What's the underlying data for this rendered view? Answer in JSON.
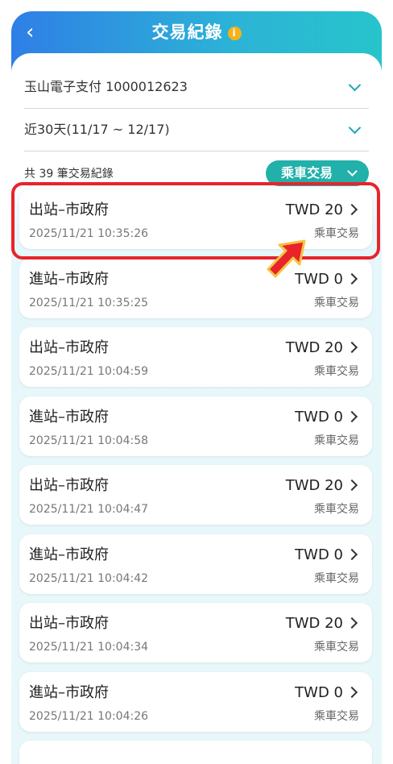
{
  "header": {
    "title": "交易紀錄",
    "info_glyph": "i"
  },
  "account_select": {
    "value": "玉山電子支付 1000012623"
  },
  "period_select": {
    "value": "近30天(11/17 ~ 12/17)"
  },
  "summary": {
    "count_text": "共 39 筆交易紀錄",
    "filter_label": "乘車交易"
  },
  "colors": {
    "header_start": "#2f7fe6",
    "header_end": "#27c4cc",
    "accent": "#22b0aa",
    "highlight": "#e8232a",
    "arrow": "#e8232a"
  },
  "transactions": [
    {
      "name": "出站–市政府",
      "time": "2025/11/21 10:35:26",
      "amount": "TWD 20",
      "type": "乘車交易"
    },
    {
      "name": "進站–市政府",
      "time": "2025/11/21 10:35:25",
      "amount": "TWD 0",
      "type": "乘車交易"
    },
    {
      "name": "出站–市政府",
      "time": "2025/11/21 10:04:59",
      "amount": "TWD 20",
      "type": "乘車交易"
    },
    {
      "name": "進站–市政府",
      "time": "2025/11/21 10:04:58",
      "amount": "TWD 0",
      "type": "乘車交易"
    },
    {
      "name": "出站–市政府",
      "time": "2025/11/21 10:04:47",
      "amount": "TWD 20",
      "type": "乘車交易"
    },
    {
      "name": "進站–市政府",
      "time": "2025/11/21 10:04:42",
      "amount": "TWD 0",
      "type": "乘車交易"
    },
    {
      "name": "出站–市政府",
      "time": "2025/11/21 10:04:34",
      "amount": "TWD 20",
      "type": "乘車交易"
    },
    {
      "name": "進站–市政府",
      "time": "2025/11/21 10:04:26",
      "amount": "TWD 0",
      "type": "乘車交易"
    }
  ]
}
